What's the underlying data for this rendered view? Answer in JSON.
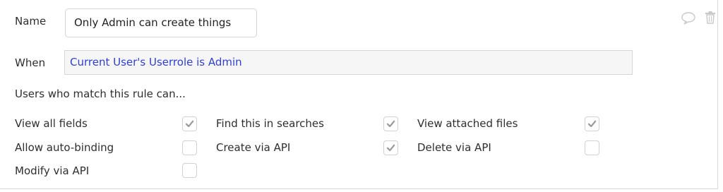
{
  "rule": {
    "name_label": "Name",
    "name_value": "Only Admin can create things",
    "when_label": "When",
    "when_value": "Current User's Userrole is Admin",
    "section_heading": "Users who match this rule can..."
  },
  "permissions": [
    {
      "label": "View all fields",
      "checked": true
    },
    {
      "label": "Find this in searches",
      "checked": true
    },
    {
      "label": "View attached files",
      "checked": true
    },
    {
      "label": "Allow auto-binding",
      "checked": false
    },
    {
      "label": "Create via API",
      "checked": true
    },
    {
      "label": "Delete via API",
      "checked": false
    },
    {
      "label": "Modify via API",
      "checked": false
    }
  ],
  "icons": {
    "comment": "comment-icon",
    "delete": "trash-icon"
  },
  "colors": {
    "expression_text": "#2f3fd1",
    "checkmark": "#9a9a9a",
    "icon": "#c9c9c9"
  }
}
